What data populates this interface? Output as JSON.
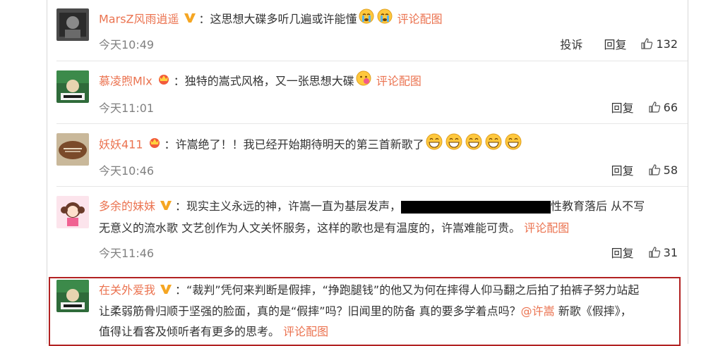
{
  "comments": [
    {
      "username": "MarsZ风雨逍遥",
      "badge": "V",
      "colon": "：",
      "text": "这思想大碟多听几遍或许能懂",
      "pic_link": "评论配图",
      "time": "今天10:49",
      "report": "投诉",
      "reply": "回复",
      "likes": "132"
    },
    {
      "username": "慕凌煦Mlx",
      "badge": "crown",
      "colon": "：",
      "text": "独特的嵩式风格，又一张思想大碟",
      "pic_link": "评论配图",
      "time": "今天11:01",
      "reply": "回复",
      "likes": "66"
    },
    {
      "username": "妖妖411",
      "badge": "crown",
      "colon": "：",
      "text": "许嵩绝了！！我已经开始期待明天的第三首新歌了",
      "time": "今天10:46",
      "reply": "回复",
      "likes": "58"
    },
    {
      "username": "多余的妹妹",
      "badge": "V",
      "colon": "：",
      "text_before": "现实主义永远的神，许嵩一直为基层发声，",
      "text_after": "性教育落后 从不写",
      "text_line2": "无意义的流水歌 文艺创作为人文关怀服务，这样的歌也是有温度的，许嵩难能可贵。",
      "pic_link": "评论配图",
      "time": "今天11:46",
      "reply": "回复",
      "likes": "31"
    },
    {
      "username": "在关外爱我",
      "badge": "V",
      "colon": "：",
      "line1": "“裁判”凭何来判断是假摔，“挣跑腿钱”的他又为何在摔得人仰马翻之后拍了拍裤子努力站起",
      "line2_before": "让柔弱筋骨归顺于坚强的脸面，真的是“假摔”吗？旧闻里的防备 真的要多学着点吗？",
      "mention": "@许嵩",
      "line2_after": " 新歌《假摔》，",
      "line3": "值得让看客及倾听者有更多的思考。",
      "pic_link": "评论配图"
    }
  ],
  "colors": {
    "accent": "#eb7350",
    "vip": "#f5a623",
    "highlight_border": "#b22222",
    "time": "#808080"
  }
}
